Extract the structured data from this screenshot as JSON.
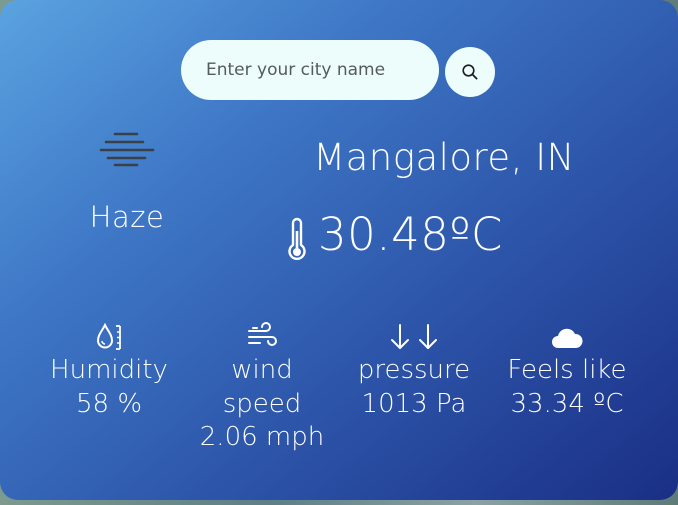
{
  "search": {
    "placeholder": "Enter your city name"
  },
  "current": {
    "condition": "Haze",
    "location": "Mangalore, IN",
    "temperature": "30.48ºC"
  },
  "stats": {
    "humidity": {
      "label": "Humidity",
      "value": "58 %"
    },
    "wind": {
      "label_line1": "wind",
      "label_line2": "speed",
      "value": "2.06 mph"
    },
    "pressure": {
      "label": "pressure",
      "value": "1013 Pa"
    },
    "feels_like": {
      "label": "Feels like",
      "value": "33.34 ºC"
    }
  },
  "icons": {
    "search": "search-icon",
    "condition": "haze-icon",
    "temperature": "thermometer-icon",
    "humidity": "humidity-drop-icon",
    "wind": "wind-icon",
    "pressure": "down-arrows-icon",
    "feels_like": "cloud-icon"
  },
  "colors": {
    "card_gradient_start": "#5aa3e0",
    "card_gradient_end": "#1a2f86",
    "input_background": "#ecfdfb",
    "text": "#ffffff"
  }
}
